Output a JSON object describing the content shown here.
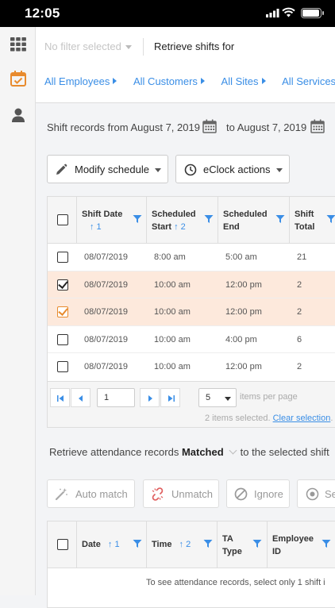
{
  "status": {
    "time": "12:05"
  },
  "filter": {
    "placeholder": "No filter selected",
    "retrieve_label": "Retrieve shifts for",
    "crumbs": [
      "All Employees",
      "All Customers",
      "All Sites",
      "All Services"
    ]
  },
  "range": {
    "from_text": "Shift records from August 7, 2019",
    "to_text": "to August 7, 2019"
  },
  "toolbar": {
    "modify_label": "Modify schedule",
    "eclock_label": "eClock actions"
  },
  "shifts": {
    "columns": [
      {
        "label1": "Shift Date",
        "label2": "",
        "sort": "↑ 1"
      },
      {
        "label1": "Scheduled",
        "label2": "Start",
        "sort": "↑ 2"
      },
      {
        "label1": "Scheduled",
        "label2": "End",
        "sort": ""
      },
      {
        "label1": "Shift",
        "label2": "Total",
        "sort": ""
      }
    ],
    "rows": [
      {
        "date": "08/07/2019",
        "start": "8:00 am",
        "end": "5:00 am",
        "total": "21",
        "checked": false
      },
      {
        "date": "08/07/2019",
        "start": "10:00 am",
        "end": "12:00 pm",
        "total": "2",
        "checked": true
      },
      {
        "date": "08/07/2019",
        "start": "10:00 am",
        "end": "12:00 pm",
        "total": "2",
        "checked": true
      },
      {
        "date": "08/07/2019",
        "start": "10:00 am",
        "end": "4:00 pm",
        "total": "6",
        "checked": false
      },
      {
        "date": "08/07/2019",
        "start": "10:00 am",
        "end": "12:00 pm",
        "total": "2",
        "checked": false
      }
    ],
    "pager": {
      "page": "1",
      "page_size": "5",
      "items_per_page": "items per page",
      "selected_text": "2 items selected.",
      "clear_text": "Clear selection",
      "trailing": ". 1"
    }
  },
  "attendance": {
    "prefix": "Retrieve attendance records",
    "mode": "Matched",
    "suffix": "to the selected shift",
    "buttons": {
      "auto_match": "Auto match",
      "unmatch": "Unmatch",
      "ignore": "Ignore",
      "more": "Se"
    },
    "columns": [
      {
        "label1": "Date",
        "label2": "",
        "sort": "↑ 1"
      },
      {
        "label1": "Time",
        "label2": "",
        "sort": "↑ 2"
      },
      {
        "label1": "TA",
        "label2": "Type",
        "sort": ""
      },
      {
        "label1": "Employee",
        "label2": "ID",
        "sort": ""
      }
    ],
    "empty_text": "To see attendance records, select only 1 shift i"
  }
}
